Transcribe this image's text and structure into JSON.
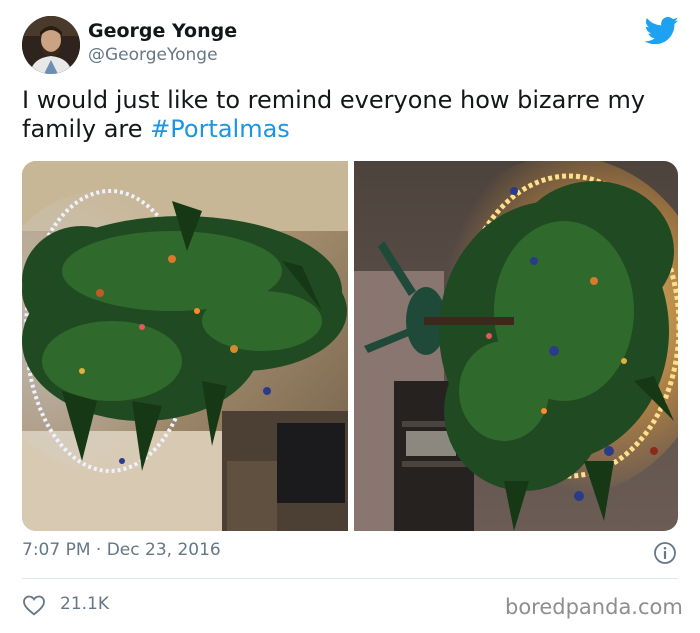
{
  "author": {
    "name": "George Yonge",
    "handle": "@GeorgeYonge",
    "avatar_icon": "profile-photo"
  },
  "brand_icon": "twitter-bird-icon",
  "brand_color": "#1da1f2",
  "tweet": {
    "text_line1": "I would just like to remind everyone how bizarre my",
    "text_line2_prefix": "family are ",
    "hashtag": "#Portalmas",
    "hashtag_color": "#1b95e0"
  },
  "media": {
    "photos": [
      {
        "description_icon": "upside-down-christmas-tree-left"
      },
      {
        "description_icon": "upside-down-christmas-tree-right"
      }
    ]
  },
  "meta": {
    "timestamp": "7:07 PM · Dec 23, 2016",
    "info_icon": "info-icon"
  },
  "engagement": {
    "likes": "21.1K",
    "like_icon": "heart-icon"
  },
  "watermark": "boredpanda.com"
}
